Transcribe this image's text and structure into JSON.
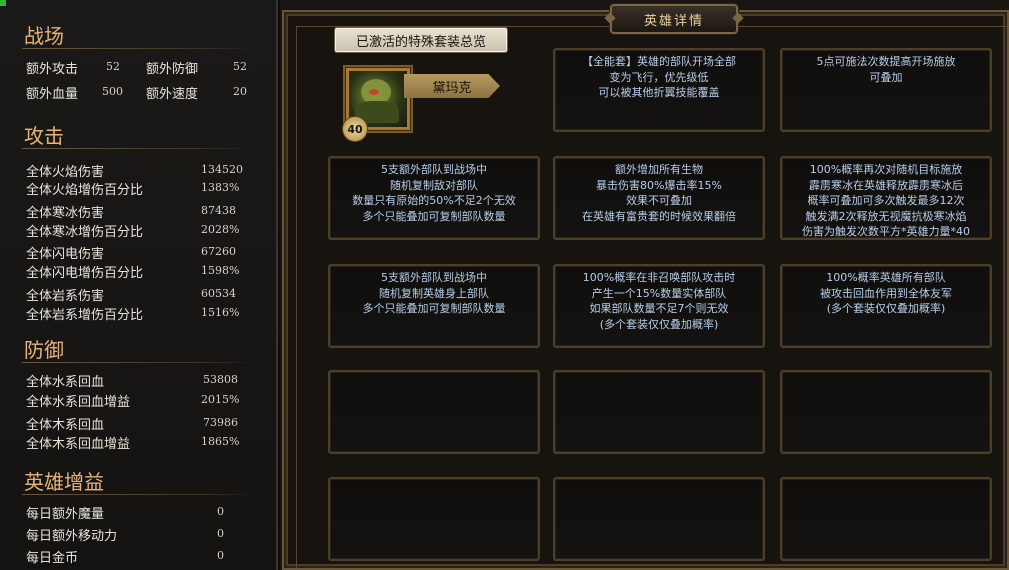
{
  "left": {
    "battle": {
      "title": "战场",
      "stats": [
        {
          "label": "额外攻击",
          "value": "52"
        },
        {
          "label": "额外防御",
          "value": "52"
        },
        {
          "label": "额外血量",
          "value": "500"
        },
        {
          "label": "额外速度",
          "value": "20"
        }
      ]
    },
    "attack": {
      "title": "攻击",
      "stats": [
        {
          "label": "全体火焰伤害",
          "value": "134520"
        },
        {
          "label": "全体火焰增伤百分比",
          "value": "1383%"
        },
        {
          "label": "全体寒冰伤害",
          "value": "87438"
        },
        {
          "label": "全体寒冰增伤百分比",
          "value": "2028%"
        },
        {
          "label": "全体闪电伤害",
          "value": "67260"
        },
        {
          "label": "全体闪电增伤百分比",
          "value": "1598%"
        },
        {
          "label": "全体岩系伤害",
          "value": "60534"
        },
        {
          "label": "全体岩系增伤百分比",
          "value": "1516%"
        }
      ]
    },
    "defense": {
      "title": "防御",
      "stats": [
        {
          "label": "全体水系回血",
          "value": "53808"
        },
        {
          "label": "全体水系回血增益",
          "value": "2015%"
        },
        {
          "label": "全体木系回血",
          "value": "73986"
        },
        {
          "label": "全体木系回血增益",
          "value": "1865%"
        }
      ]
    },
    "buff": {
      "title": "英雄增益",
      "stats": [
        {
          "label": "每日额外魔量",
          "value": "0"
        },
        {
          "label": "每日额外移动力",
          "value": "0"
        },
        {
          "label": "每日金币",
          "value": "0"
        }
      ]
    }
  },
  "main": {
    "title": "英雄详情",
    "overview_button": "已激活的特殊套装总览",
    "hero": {
      "name": "黛玛克",
      "level": "40",
      "portrait_icon": "hero-portrait-icon"
    },
    "cards": [
      "【全能套】英雄的部队开场全部\n变为飞行，优先级低\n可以被其他折翼技能覆盖",
      "5点可施法次数提高开场施放\n可叠加",
      "5支额外部队到战场中\n随机复制敌对部队\n数量只有原始的50%不足2个无效\n多个只能叠加可复制部队数量",
      "额外增加所有生物\n暴击伤害80%爆击率15%\n效果不可叠加\n在英雄有富贵套的时候效果翻倍",
      "100%概率再次对随机目标施放\n霹雳寒冰在英雄释放霹雳寒冰后\n概率可叠加可多次触发最多12次\n触发满2次释放无视魔抗极寒冰焰\n伤害为触发次数平方*英雄力量*40",
      "5支额外部队到战场中\n随机复制英雄身上部队\n多个只能叠加可复制部队数量",
      "100%概率在非召唤部队攻击时\n产生一个15%数量实体部队\n如果部队数量不足7个则无效\n(多个套装仅仅叠加概率)",
      "100%概率英雄所有部队\n被攻击回血作用到全体友军\n(多个套装仅仅叠加概率)",
      "",
      "",
      "",
      "",
      "",
      ""
    ]
  }
}
